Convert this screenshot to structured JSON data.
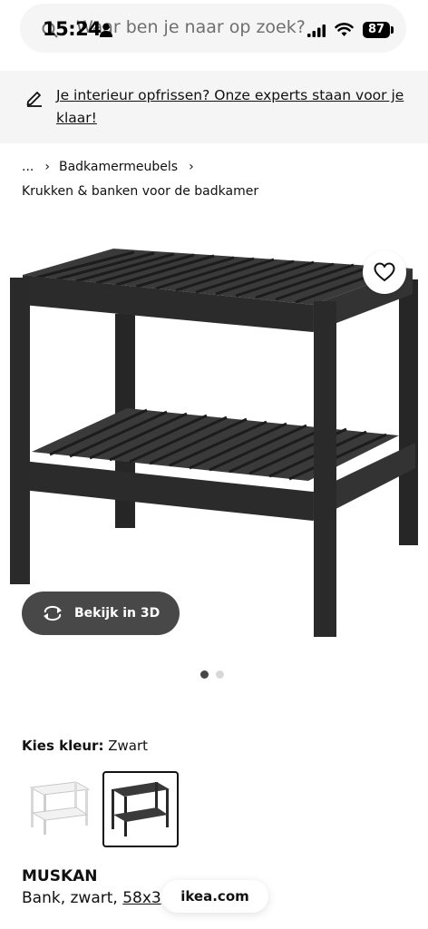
{
  "status_bar": {
    "time": "15:24",
    "battery": "87"
  },
  "search": {
    "placeholder": "Waar ben je naar op zoek?"
  },
  "banner": {
    "text": "Je interieur opfrissen? Onze experts staan voor je klaar!"
  },
  "breadcrumb": {
    "items": [
      "...",
      "Badkamermeubels"
    ],
    "subcategory": "Krukken & banken voor de badkamer"
  },
  "product_image": {
    "view3d_label": "Bekijk in 3D",
    "slide_count": 2,
    "active_slide": 1
  },
  "color": {
    "label": "Kies kleur:",
    "value": "Zwart",
    "options": [
      "wit",
      "zwart"
    ],
    "selected": "zwart"
  },
  "product": {
    "name": "MUSKAN",
    "desc_prefix": "Bank, zwart, ",
    "dims": "58x3"
  },
  "browser": {
    "url": "ikea.com"
  },
  "colors": {
    "banner_bg": "#f5f5f5",
    "button_dark": "#484848",
    "furniture": "#2e2e2e"
  }
}
